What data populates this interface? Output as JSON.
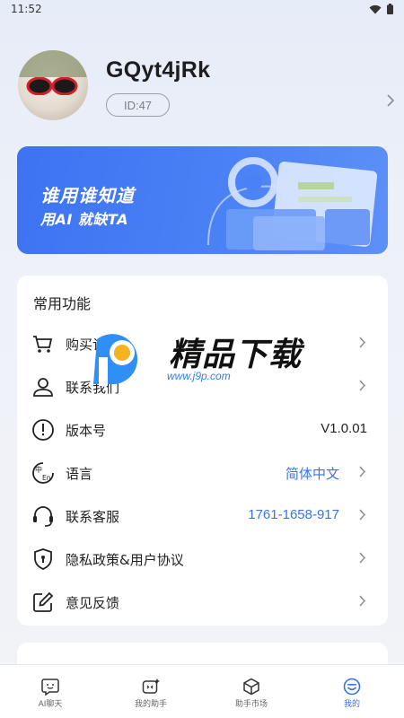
{
  "status_bar": {
    "time": "11:52"
  },
  "profile": {
    "username": "GQyt4jRk",
    "id_label": "ID:47"
  },
  "banner": {
    "title": "谁用谁知道",
    "subtitle": "用AI 就缺TA"
  },
  "section": {
    "title": "常用功能",
    "items": [
      {
        "label": "购买记录",
        "value": "",
        "icon": "cart-icon",
        "chevron": true
      },
      {
        "label": "联系我们",
        "value": "",
        "icon": "user-icon",
        "chevron": true
      },
      {
        "label": "版本号",
        "value": "V1.0.01",
        "icon": "info-icon",
        "chevron": false
      },
      {
        "label": "语言",
        "value": "简体中文",
        "icon": "language-icon",
        "chevron": true
      },
      {
        "label": "联系客服",
        "value": "1761-1658-917",
        "icon": "headset-icon",
        "chevron": true
      },
      {
        "label": "隐私政策&用户协议",
        "value": "",
        "icon": "shield-icon",
        "chevron": true
      },
      {
        "label": "意见反馈",
        "value": "",
        "icon": "edit-icon",
        "chevron": true
      }
    ]
  },
  "watermark": {
    "text": "精品下载",
    "url": "www.j9p.com"
  },
  "tabbar": {
    "tabs": [
      {
        "label": "AI聊天",
        "icon": "chat-face-icon",
        "active": false
      },
      {
        "label": "我的助手",
        "icon": "assistant-icon",
        "active": false
      },
      {
        "label": "助手市场",
        "icon": "cube-icon",
        "active": false
      },
      {
        "label": "我的",
        "icon": "profile-face-icon",
        "active": true
      }
    ]
  },
  "colors": {
    "accent": "#3a73e8",
    "banner": "#4a81f5",
    "background": "#eef1f8"
  }
}
